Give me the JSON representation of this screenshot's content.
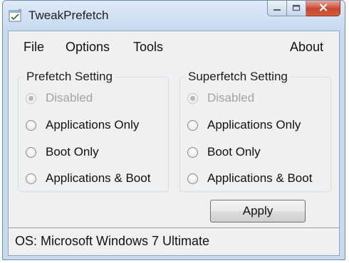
{
  "window": {
    "title": "TweakPrefetch"
  },
  "menu": {
    "file": "File",
    "options": "Options",
    "tools": "Tools",
    "about": "About"
  },
  "prefetch": {
    "title": "Prefetch Setting",
    "options": [
      "Disabled",
      "Applications Only",
      "Boot Only",
      "Applications & Boot"
    ],
    "selected": "Disabled"
  },
  "superfetch": {
    "title": "Superfetch Setting",
    "options": [
      "Disabled",
      "Applications Only",
      "Boot Only",
      "Applications & Boot"
    ],
    "selected": "Disabled"
  },
  "apply_label": "Apply",
  "status": "OS: Microsoft Windows 7 Ultimate",
  "icons": [
    "app-icon",
    "minimize-icon",
    "maximize-icon",
    "close-icon"
  ],
  "colors": {
    "close_button": "#c7462f",
    "disabled_text": "#a3a3a3",
    "frame": "#c9daef"
  }
}
